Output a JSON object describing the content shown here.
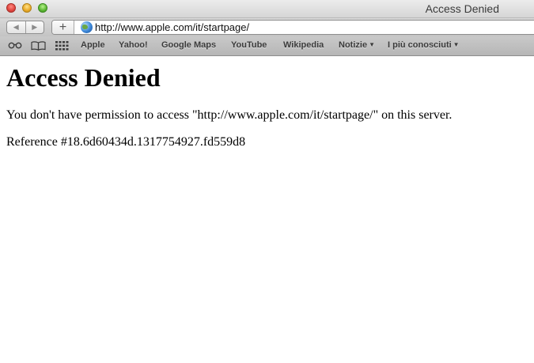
{
  "window": {
    "title": "Access Denied"
  },
  "toolbar": {
    "back_glyph": "◀",
    "forward_glyph": "▶",
    "add_glyph": "+",
    "url": "http://www.apple.com/it/startpage/"
  },
  "bookmarks": {
    "items": [
      {
        "label": "Apple"
      },
      {
        "label": "Yahoo!"
      },
      {
        "label": "Google Maps"
      },
      {
        "label": "YouTube"
      },
      {
        "label": "Wikipedia"
      },
      {
        "label": "Notizie",
        "dropdown": true
      },
      {
        "label": "I più conosciuti",
        "dropdown": true
      }
    ],
    "caret": "▼"
  },
  "page": {
    "heading": "Access Denied",
    "message": "You don't have permission to access \"http://www.apple.com/it/startpage/\" on this server.",
    "reference": "Reference #18.6d60434d.1317754927.fd559d8"
  },
  "icons": {
    "reading_list": "reading-list-icon",
    "bookmarks": "bookmarks-book-icon",
    "top_sites": "top-sites-grid-icon",
    "site": "globe-icon"
  }
}
